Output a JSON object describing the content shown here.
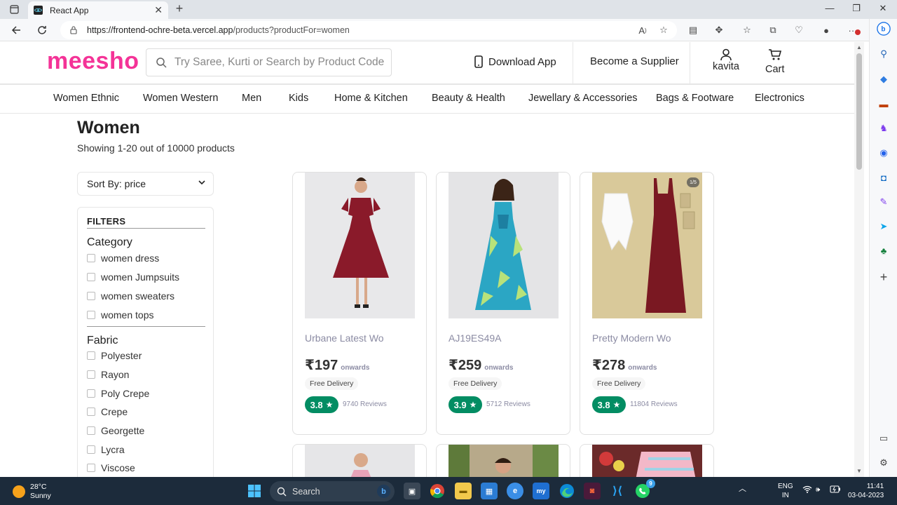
{
  "browser": {
    "tab_title": "React App",
    "url_host": "https://frontend-ochre-beta.vercel.app",
    "url_path": "/products?productFor=women"
  },
  "header": {
    "logo": "meesho",
    "search_placeholder": "Try Saree, Kurti or Search by Product Code",
    "download_app": "Download App",
    "become_supplier": "Become a Supplier",
    "profile_name": "kavita",
    "cart_label": "Cart"
  },
  "categories": [
    "Women Ethnic",
    "Women Western",
    "Men",
    "Kids",
    "Home & Kitchen",
    "Beauty & Health",
    "Jewellary & Accessories",
    "Bags & Footware",
    "Electronics"
  ],
  "page": {
    "title": "Women",
    "subtitle": "Showing 1-20 out of 10000 products",
    "sort_label": "Sort By: price"
  },
  "filters": {
    "title": "FILTERS",
    "category_heading": "Category",
    "categories": [
      "women dress",
      "women Jumpsuits",
      "women sweaters",
      "women tops"
    ],
    "fabric_heading": "Fabric",
    "fabrics": [
      "Polyester",
      "Rayon",
      "Poly Crepe",
      "Crepe",
      "Georgette",
      "Lycra",
      "Viscose"
    ]
  },
  "products": [
    {
      "name": "Urbane Latest Wo",
      "price": "₹197",
      "onwards": "onwards",
      "delivery": "Free Delivery",
      "rating": "3.8",
      "reviews": "9740 Reviews"
    },
    {
      "name": "AJ19ES49A",
      "price": "₹259",
      "onwards": "onwards",
      "delivery": "Free Delivery",
      "rating": "3.9",
      "reviews": "5712 Reviews"
    },
    {
      "name": "Pretty Modern Wo",
      "price": "₹278",
      "onwards": "onwards",
      "delivery": "Free Delivery",
      "rating": "3.8",
      "reviews": "11804 Reviews",
      "image_pager": "1/5"
    }
  ],
  "taskbar": {
    "temp": "28°C",
    "weather": "Sunny",
    "search_label": "Search",
    "lang_top": "ENG",
    "lang_bottom": "IN",
    "time": "11:41",
    "date": "03-04-2023",
    "whatsapp_badge": "9"
  },
  "colors": {
    "brand": "#f43397",
    "rating_green": "#038d63",
    "taskbar": "#1c2b3b"
  }
}
